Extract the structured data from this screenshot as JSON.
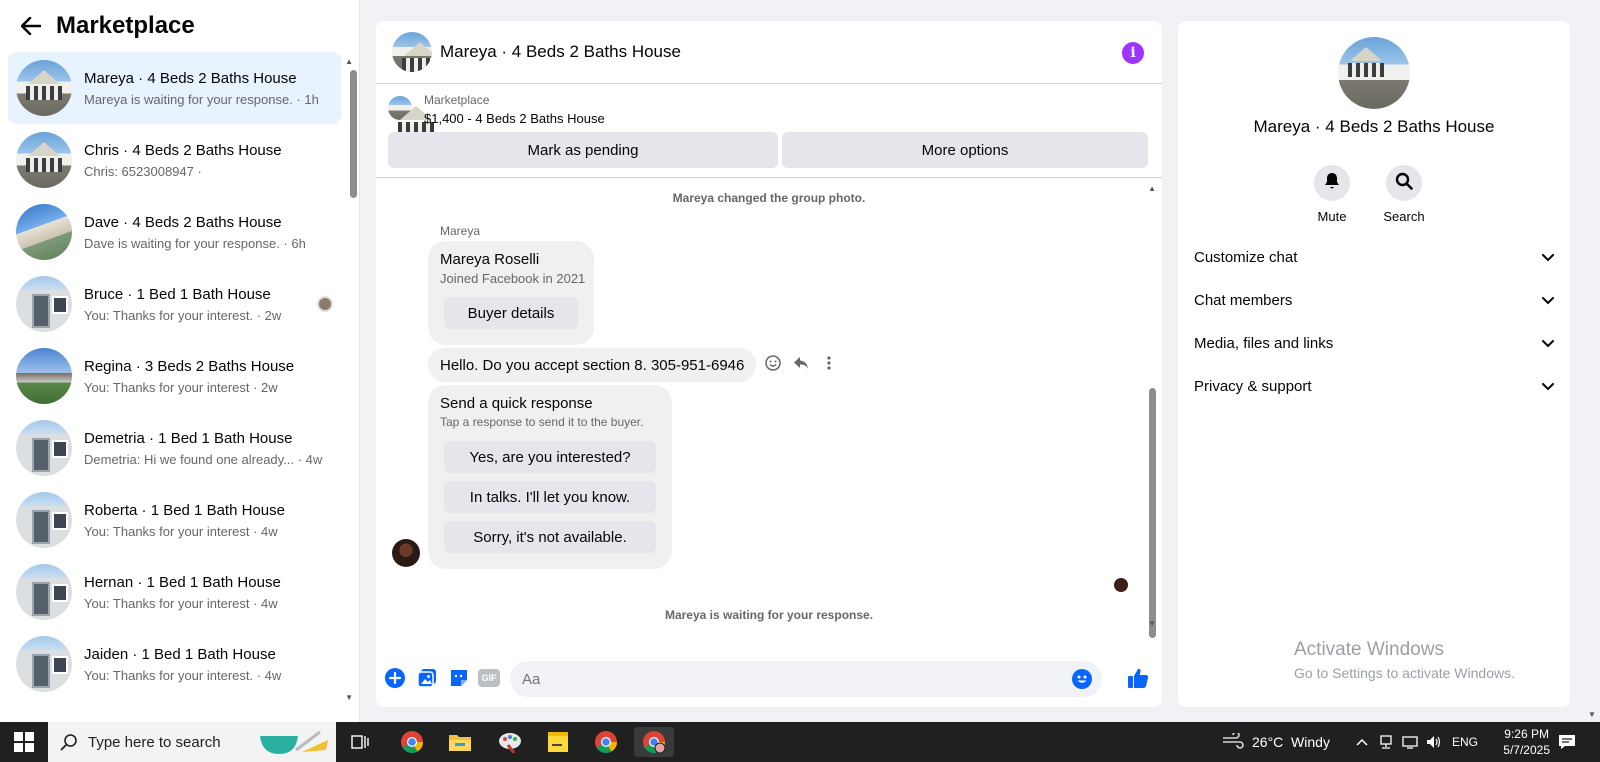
{
  "sidebar": {
    "title": "Marketplace",
    "conversations": [
      {
        "name": "Mareya · 4 Beds 2 Baths House",
        "preview": "Mareya is waiting for your response. · 1h"
      },
      {
        "name": "Chris · 4 Beds 2 Baths House",
        "preview": "Chris: 6523008947 ·"
      },
      {
        "name": "Dave · 4 Beds 2 Baths House",
        "preview": "Dave is waiting for your response. · 6h"
      },
      {
        "name": "Bruce · 1 Bed 1 Bath House",
        "preview": "You: Thanks for your interest. · 2w"
      },
      {
        "name": "Regina · 3 Beds 2 Baths House",
        "preview": "You: Thanks for your interest · 2w"
      },
      {
        "name": "Demetria · 1 Bed 1 Bath House",
        "preview": "Demetria: Hi we found one already... · 4w"
      },
      {
        "name": "Roberta · 1 Bed 1 Bath House",
        "preview": "You: Thanks for your interest · 4w"
      },
      {
        "name": "Hernan · 1 Bed 1 Bath House",
        "preview": "You: Thanks for your interest · 4w"
      },
      {
        "name": "Jaiden · 1 Bed 1 Bath House",
        "preview": "You: Thanks for your interest. · 4w"
      }
    ]
  },
  "chat": {
    "title": "Mareya · 4 Beds 2 Baths House",
    "listing": {
      "source": "Marketplace",
      "price_title": "$1,400 - 4 Beds 2 Baths House",
      "mark_pending": "Mark as pending",
      "more_options": "More options"
    },
    "system_top": "Mareya changed the group photo.",
    "sender_label": "Mareya",
    "card": {
      "name": "Mareya Roselli",
      "joined": "Joined Facebook in 2021",
      "button": "Buyer details"
    },
    "message_text": "Hello. Do you accept section 8. 305-951-6946",
    "quick_response": {
      "title": "Send a quick response",
      "subtitle": "Tap a response to send it to the buyer.",
      "options": [
        "Yes, are you interested?",
        "In talks. I'll let you know.",
        "Sorry, it's not available."
      ]
    },
    "system_bottom": "Mareya is waiting for your response.",
    "composer_placeholder": "Aa"
  },
  "panel": {
    "name": "Mareya · 4 Beds 2 Baths House",
    "mute_label": "Mute",
    "search_label": "Search",
    "sections": [
      "Customize chat",
      "Chat members",
      "Media, files and links",
      "Privacy & support"
    ]
  },
  "watermark": {
    "line1": "Activate Windows",
    "line2": "Go to Settings to activate Windows."
  },
  "taskbar": {
    "search_placeholder": "Type here to search",
    "weather": "26°C  Windy",
    "language": "ENG",
    "time": "9:26 PM",
    "date": "5/7/2025"
  },
  "colors": {
    "accent_blue": "#0866ff",
    "info_purple": "#a033ff",
    "active_row": "#e7f3ff"
  }
}
